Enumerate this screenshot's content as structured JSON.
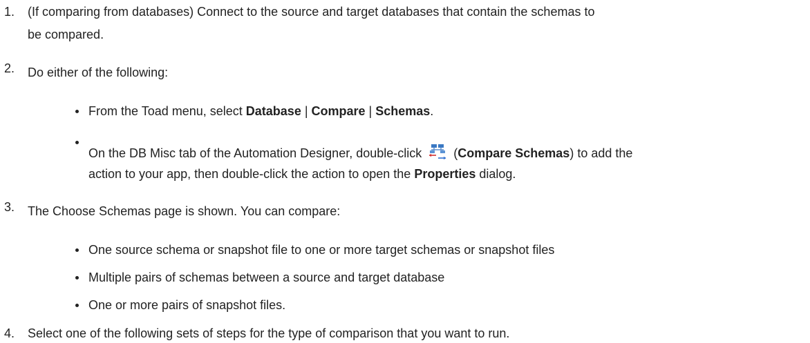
{
  "steps": [
    {
      "number": "1.",
      "lines": [
        "(If comparing from databases) Connect to the source and target databases that contain the schemas to",
        "be compared."
      ]
    },
    {
      "number": "2.",
      "text": "Do either of the following:",
      "bullets": [
        {
          "pre": "From the Toad menu, select ",
          "b1": "Database",
          "sep1": " | ",
          "b2": "Compare",
          "sep2": " | ",
          "b3": "Schemas",
          "post": "."
        },
        {
          "pre": "On the DB Misc tab of the Automation Designer, double-click ",
          "icon_name": "compare-schemas-icon",
          "paren_open": " (",
          "bold": "Compare Schemas",
          "post": ") to add the",
          "line2_pre": "action to your app, then double-click the action to open the ",
          "line2_bold": "Properties",
          "line2_post": " dialog."
        }
      ]
    },
    {
      "number": "3.",
      "text": "The Choose Schemas page is shown. You can compare:",
      "bullets": [
        "One source schema or snapshot file to one or more target schemas or snapshot files",
        "Multiple pairs of schemas between a source and target database",
        "One or more pairs of snapshot files."
      ]
    },
    {
      "number": "4.",
      "text": "Select one of the following sets of steps for the type of comparison that you want to run."
    }
  ]
}
